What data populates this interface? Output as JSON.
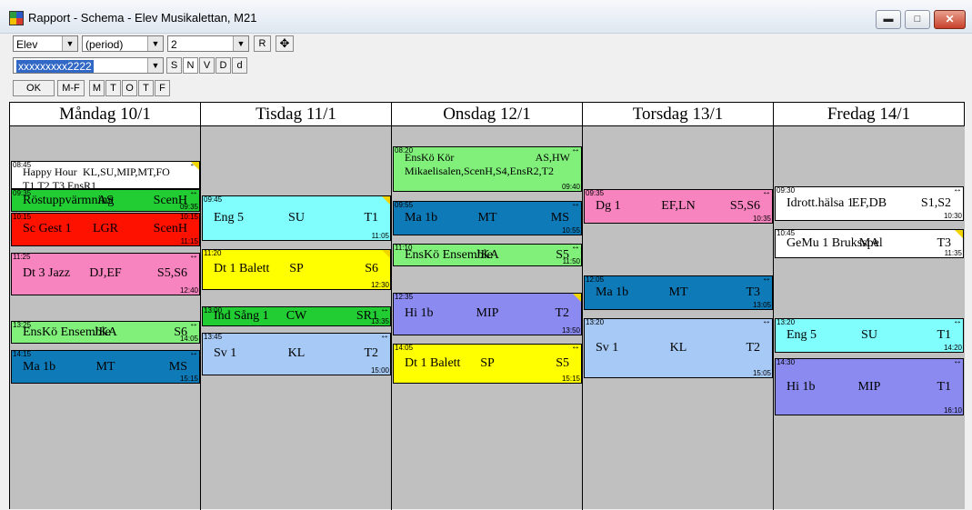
{
  "window": {
    "title": "Rapport - Schema - Elev Musikalettan, M21",
    "min_label": "▬",
    "max_label": "□",
    "close_label": "✕"
  },
  "toolbar": {
    "type_select": "Elev",
    "period_select": "(period)",
    "week_select": "2",
    "r_button": "R",
    "name_field": "xxxxxxxxx2222",
    "s_button": "S",
    "n_button": "N",
    "v_button": "V",
    "d_upper_button": "D",
    "d_lower_button": "d",
    "ok_button": "OK",
    "mf_button": "M-F",
    "m_button": "M",
    "t1_button": "T",
    "o_button": "O",
    "t2_button": "T",
    "f_button": "F"
  },
  "days": [
    "Måndag 10/1",
    "Tisdag 11/1",
    "Onsdag 12/1",
    "Torsdag 13/1",
    "Fredag 14/1"
  ],
  "colors": {
    "white": "#ffffff",
    "green": "#22cc33",
    "red": "#ff1100",
    "pink": "#f884bf",
    "lightgreen": "#80f07a",
    "blue": "#0f7ab8",
    "cyan": "#80fdfd",
    "yellow": "#ffff00",
    "lightblue": "#a7c9f5",
    "purple": "#8a8af0"
  },
  "events": [
    {
      "day": 0,
      "start": "08:45",
      "end": "",
      "color": "white",
      "c1": "Happy Hour",
      "c2": "KL,SU,MIP,MT,FO",
      "line2": "T1,T2,T3,EnsR1",
      "mv": true,
      "flag": true
    },
    {
      "day": 0,
      "start": "09:35",
      "end": "09:35",
      "color": "green",
      "c1": "Röstuppvärmning",
      "c2": "AS",
      "c3": "ScenH",
      "mv": true
    },
    {
      "day": 0,
      "start": "10:15",
      "end": "11:15",
      "color": "red",
      "c1": "Sc Gest 1",
      "c2": "LGR",
      "c3": "ScenH",
      "mv": false,
      "endlbl_top": "10:15"
    },
    {
      "day": 0,
      "start": "11:25",
      "end": "12:40",
      "color": "pink",
      "c1": "Dt 3 Jazz",
      "c2": "DJ,EF",
      "c3": "S5,S6",
      "mv": true
    },
    {
      "day": 0,
      "start": "13:25",
      "end": "14:05",
      "color": "lightgreen",
      "c1": "EnsKö Ensemble",
      "c2": "JKA",
      "c3": "S6",
      "mv": true
    },
    {
      "day": 0,
      "start": "14:15",
      "end": "15:15",
      "color": "blue",
      "c1": "Ma 1b",
      "c2": "MT",
      "c3": "MS",
      "mv": true
    },
    {
      "day": 1,
      "start": "09:45",
      "end": "11:05",
      "color": "cyan",
      "c1": "Eng 5",
      "c2": "SU",
      "c3": "T1",
      "mv": false,
      "flag": true
    },
    {
      "day": 1,
      "start": "11:20",
      "end": "12:30",
      "color": "yellow",
      "c1": "Dt 1 Balett",
      "c2": "SP",
      "c3": "S6",
      "mv": false,
      "flag": true
    },
    {
      "day": 1,
      "start": "13:00",
      "end": "13:35",
      "color": "green",
      "c1": "Ind Sång 1",
      "c2": "CW",
      "c3": "SR1",
      "mv": true
    },
    {
      "day": 1,
      "start": "13:45",
      "end": "15:00",
      "color": "lightblue",
      "c1": "Sv 1",
      "c2": "KL",
      "c3": "T2",
      "mv": true
    },
    {
      "day": 2,
      "start": "08:20",
      "end": "09:40",
      "color": "lightgreen",
      "c1": "EnsKö Kör",
      "c2": "AS,HW",
      "line2": "Mikaelisalen,ScenH,S4,EnsR2,T2",
      "mv": true
    },
    {
      "day": 2,
      "start": "09:55",
      "end": "10:55",
      "color": "blue",
      "c1": "Ma 1b",
      "c2": "MT",
      "c3": "MS",
      "mv": true
    },
    {
      "day": 2,
      "start": "11:10",
      "end": "11:50",
      "color": "lightgreen",
      "c1": "EnsKö Ensemble",
      "c2": "JKA",
      "c3": "S5",
      "mv": true
    },
    {
      "day": 2,
      "start": "12:35",
      "end": "13:50",
      "color": "purple",
      "c1": "Hi 1b",
      "c2": "MIP",
      "c3": "T2",
      "mv": false,
      "flag": true
    },
    {
      "day": 2,
      "start": "14:05",
      "end": "15:15",
      "color": "yellow",
      "c1": "Dt 1 Balett",
      "c2": "SP",
      "c3": "S5",
      "mv": true
    },
    {
      "day": 3,
      "start": "09:35",
      "end": "10:35",
      "color": "pink",
      "c1": "Dg 1",
      "c2": "EF,LN",
      "c3": "S5,S6",
      "mv": true
    },
    {
      "day": 3,
      "start": "12:05",
      "end": "13:05",
      "color": "blue",
      "c1": "Ma 1b",
      "c2": "MT",
      "c3": "T3",
      "mv": true
    },
    {
      "day": 3,
      "start": "13:20",
      "end": "15:05",
      "color": "lightblue",
      "c1": "Sv 1",
      "c2": "KL",
      "c3": "T2",
      "mv": true
    },
    {
      "day": 4,
      "start": "09:30",
      "end": "10:30",
      "color": "white",
      "c1": "Idrott.hälsa 1",
      "c2": "EF,DB",
      "c3": "S1,S2",
      "mv": true
    },
    {
      "day": 4,
      "start": "10:45",
      "end": "11:35",
      "color": "white",
      "c1": "GeMu 1 Bruksspel",
      "c2": "MA",
      "c3": "T3",
      "mv": false,
      "flag": true
    },
    {
      "day": 4,
      "start": "13:20",
      "end": "14:20",
      "color": "cyan",
      "c1": "Eng 5",
      "c2": "SU",
      "c3": "T1",
      "mv": true
    },
    {
      "day": 4,
      "start": "14:30",
      "end": "16:10",
      "color": "purple",
      "c1": "Hi 1b",
      "c2": "MIP",
      "c3": "T1",
      "mv": true
    }
  ]
}
